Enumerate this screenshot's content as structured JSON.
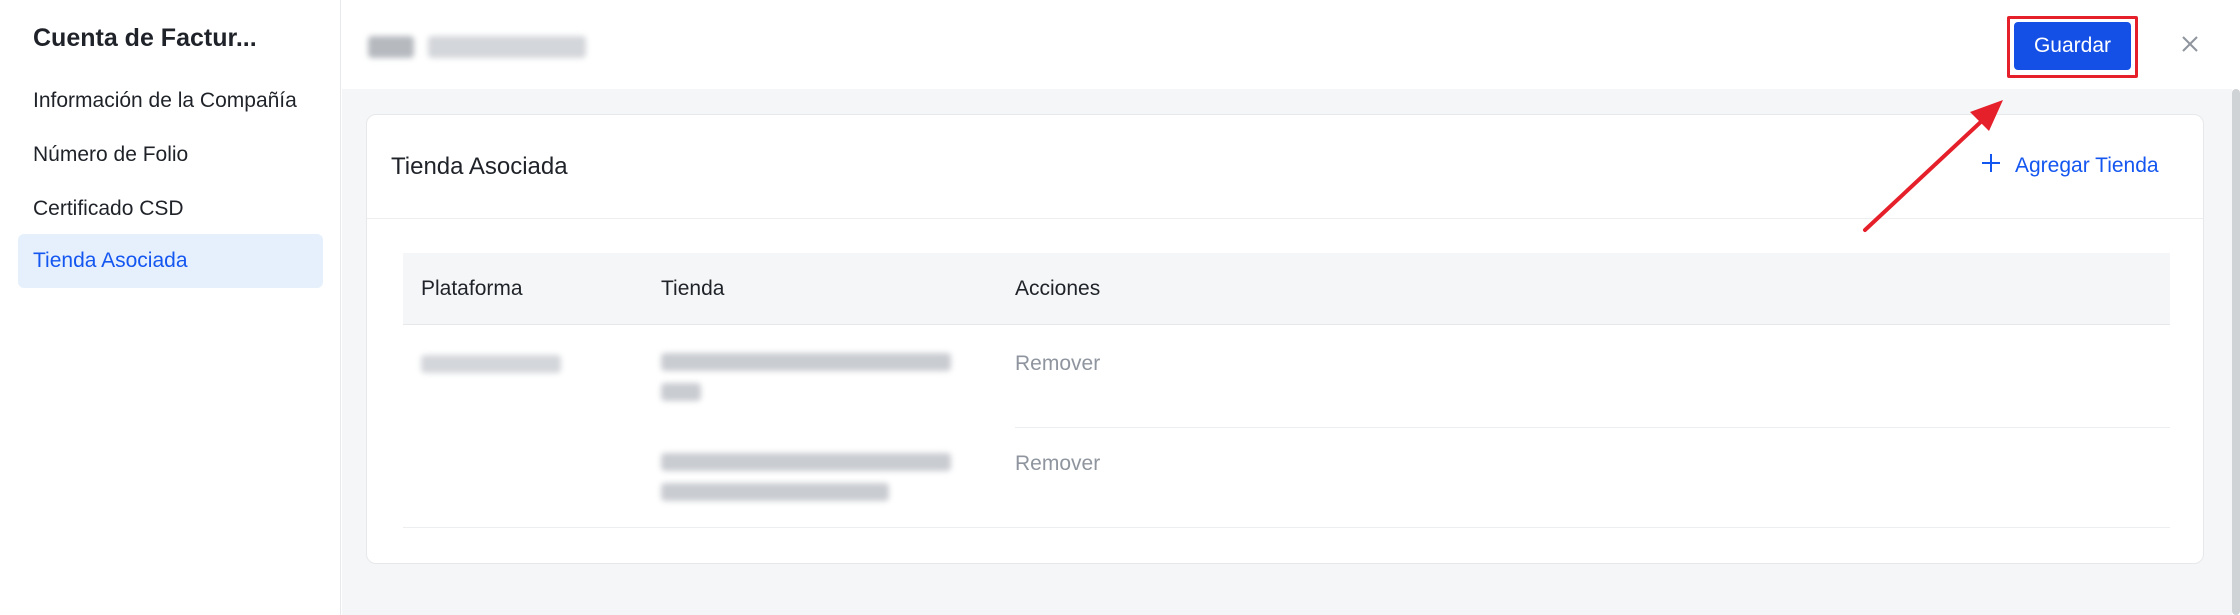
{
  "sidebar": {
    "title": "Cuenta de Factur...",
    "items": [
      {
        "label": "Información de la Compañía",
        "active": false
      },
      {
        "label": "Número de Folio",
        "active": false
      },
      {
        "label": "Certificado CSD",
        "active": false
      },
      {
        "label": "Tienda Asociada",
        "active": true
      }
    ]
  },
  "header": {
    "save_label": "Guardar",
    "close_icon": "close-icon"
  },
  "card": {
    "title": "Tienda Asociada",
    "add_store_label": "Agregar Tienda",
    "add_icon": "plus-icon"
  },
  "table": {
    "columns": [
      "Plataforma",
      "Tienda",
      "Acciones"
    ],
    "rows": [
      {
        "action": "Remover"
      },
      {
        "action": "Remover"
      }
    ]
  },
  "colors": {
    "accent": "#1550e6",
    "link": "#1456f0",
    "annotation": "#e5202a",
    "active_bg": "#e6f0fd"
  }
}
